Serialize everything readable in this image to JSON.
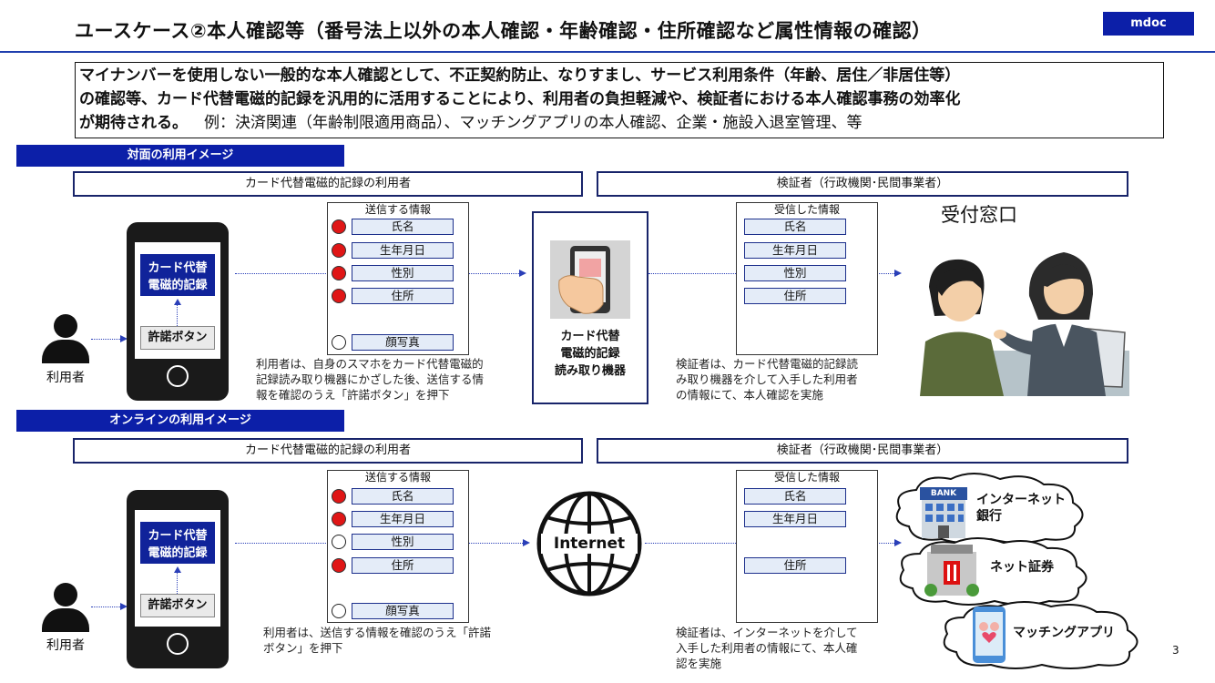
{
  "header": {
    "title": "ユースケース②本人確認等（番号法上以外の本人確認・年齢確認・住所確認など属性情報の確認）",
    "logo": "mdoc"
  },
  "summary": {
    "line1": "マイナンバーを使用しない一般的な本人確認として、不正契約防止、なりすまし、サービス利用条件（年齢、居住／非居住等）",
    "line2": "の確認等、カード代替電磁的記録を汎用的に活用することにより、利用者の負担軽減や、検証者における本人確認事務の効率化",
    "line3": "が期待される。",
    "example": "例：決済関連（年齢制限適用商品）、マッチングアプリの本人確認、企業・施設入退室管理、等"
  },
  "face": {
    "section_label": "対面の利用イメージ",
    "user_role": "カード代替電磁的記録の利用者",
    "verifier_role": "検証者（行政機関･民間事業者）",
    "phone_record_line1": "カード代替",
    "phone_record_line2": "電磁的記録",
    "consent_button": "許諾ボタン",
    "user_label": "利用者",
    "send_caption": "送信する情報",
    "send_fields": [
      {
        "label": "氏名",
        "selected": true
      },
      {
        "label": "生年月日",
        "selected": true
      },
      {
        "label": "性別",
        "selected": true
      },
      {
        "label": "住所",
        "selected": true
      },
      {
        "label": "顔写真",
        "selected": false
      }
    ],
    "user_desc_line1": "利用者は、自身のスマホをカード代替電磁的",
    "user_desc_line2": "記録読み取り機器にかざした後、送信する情",
    "user_desc_line3": "報を確認のうえ「許諾ボタン」を押下",
    "reader_line1": "カード代替",
    "reader_line2": "電磁的記録",
    "reader_line3": "読み取り機器",
    "recv_caption": "受信した情報",
    "recv_fields": [
      "氏名",
      "生年月日",
      "性別",
      "住所"
    ],
    "verifier_desc_line1": "検証者は、カード代替電磁的記録読",
    "verifier_desc_line2": "み取り機器を介して入手した利用者",
    "verifier_desc_line3": "の情報にて、本人確認を実施",
    "reception": "受付窓口"
  },
  "online": {
    "section_label": "オンラインの利用イメージ",
    "user_role": "カード代替電磁的記録の利用者",
    "verifier_role": "検証者（行政機関･民間事業者）",
    "phone_record_line1": "カード代替",
    "phone_record_line2": "電磁的記録",
    "consent_button": "許諾ボタン",
    "user_label": "利用者",
    "send_caption": "送信する情報",
    "send_fields": [
      {
        "label": "氏名",
        "selected": true
      },
      {
        "label": "生年月日",
        "selected": true
      },
      {
        "label": "性別",
        "selected": false
      },
      {
        "label": "住所",
        "selected": true
      },
      {
        "label": "顔写真",
        "selected": false
      }
    ],
    "user_desc_line1": "利用者は、送信する情報を確認のうえ「許諾",
    "user_desc_line2": "ボタン」を押下",
    "internet": "Internet",
    "recv_caption": "受信した情報",
    "recv_fields": [
      "氏名",
      "生年月日",
      "住所"
    ],
    "verifier_desc_line1": "検証者は、インターネットを介して",
    "verifier_desc_line2": "入手した利用者の情報にて、本人確",
    "verifier_desc_line3": "認を実施",
    "bank_sign": "BANK",
    "services": [
      {
        "line1": "インターネット",
        "line2": "銀行"
      },
      {
        "line1": "ネット証券",
        "line2": ""
      },
      {
        "line1": "マッチングアプリ",
        "line2": ""
      }
    ]
  },
  "page_number": "3",
  "colors": {
    "navy": "#0c1fa8",
    "field_fill": "#e4ecf8",
    "selected_dot": "#e01616",
    "dotted_arrow": "#2a3fb8"
  }
}
